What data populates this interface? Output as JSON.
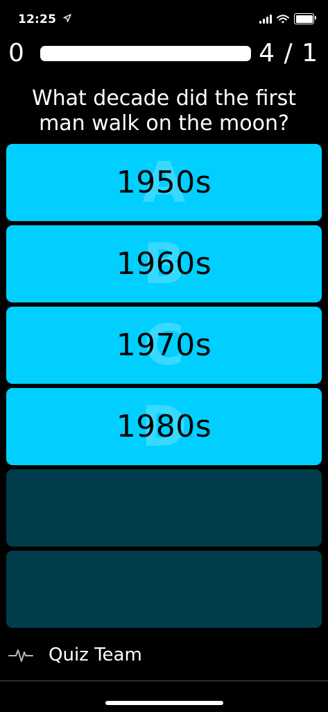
{
  "status_bar": {
    "time": "12:25",
    "icons": [
      "location-arrow-icon",
      "signal-icon",
      "wifi-icon",
      "battery-icon"
    ]
  },
  "score": {
    "left": "0",
    "right": "4 / 1",
    "progress": 0
  },
  "question": "What decade did the first man walk on the moon?",
  "answers": [
    {
      "letter": "A",
      "text": "1950s"
    },
    {
      "letter": "B",
      "text": "1960s"
    },
    {
      "letter": "C",
      "text": "1970s"
    },
    {
      "letter": "D",
      "text": "1980s"
    }
  ],
  "footer": {
    "icon": "pulse-icon",
    "label": "Quiz Team"
  },
  "colors": {
    "accent": "#00cfff",
    "empty_slot": "#003c4c",
    "background": "#000000"
  }
}
